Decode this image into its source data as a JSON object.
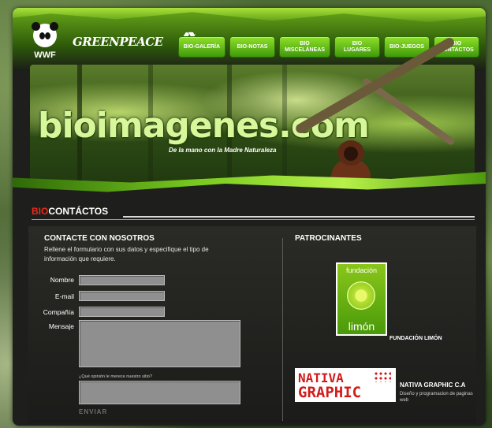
{
  "header": {
    "wwf_logo": "WWF",
    "greenpeace_logo": "GREENPEACE",
    "recycle_icon": "recycle-icon"
  },
  "nav": [
    {
      "label": "BIO-GALERÍA"
    },
    {
      "label": "BIO-NOTAS"
    },
    {
      "label": "BIO\nMISCELÁNEAS"
    },
    {
      "label": "BIO\nLUGARES"
    },
    {
      "label": "BIO-JUEGOS"
    },
    {
      "label": "BIO\nCONTACTOS"
    }
  ],
  "banner": {
    "site_name": "bioimagenes.com",
    "slogan": "De la mano con la  Madre Naturaleza"
  },
  "section": {
    "title_highlight": "BIO",
    "title_rest": "CONTÁCTOS"
  },
  "contact": {
    "heading": "CONTACTE CON NOSOTROS",
    "description": "Rellene el formulario con sus datos y especifique el tipo de información que requiere.",
    "fields": {
      "name_label": "Nombre",
      "email_label": "E-mail",
      "company_label": "Compañía",
      "message_label": "Mensaje"
    },
    "question": "¿Qué opinión le merece nuestro sitio?",
    "send_label": "ENVIAR"
  },
  "sponsors": {
    "heading": "PATROCINANTES",
    "items": [
      {
        "logo_top": "fundación",
        "logo_bottom": "limón",
        "name": "FUNDACIÓN LIMÓN"
      },
      {
        "logo_line1": "NATIVA",
        "logo_line2": "GRAPHIC",
        "name": "NATIVA GRAPHIC C.A",
        "desc": "Diseño y programacion de paginas web"
      }
    ]
  },
  "colors": {
    "accent_green": "#6aa91a",
    "highlight_red": "#e82a1a",
    "panel_bg": "#1e1f1c"
  }
}
